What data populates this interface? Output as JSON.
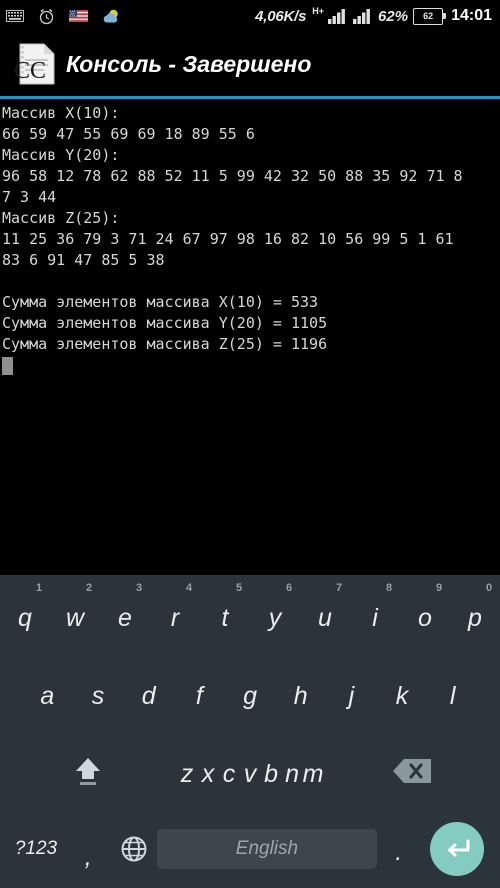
{
  "status_bar": {
    "icons": [
      "keyboard-icon",
      "alarm-clock-icon",
      "us-flag-icon",
      "weather-cloud-icon"
    ],
    "network_speed": "4,06K/s",
    "network_type": "H+",
    "battery_percent": "62%",
    "battery_level_number": "62",
    "clock": "14:01"
  },
  "title_bar": {
    "icon": "c-document-icon",
    "title": "Консоль - Завершено"
  },
  "console": {
    "accent_color": "#2196c4",
    "lines": [
      "Массив X(10):",
      "66 59 47 55 69 69 18 89 55 6",
      "Массив Y(20):",
      "96 58 12 78 62 88 52 11 5 99 42 32 50 88 35 92 71 8",
      "7 3 44",
      "Массив Z(25):",
      "11 25 36 79 3 71 24 67 97 98 16 82 10 56 99 5 1 61",
      "83 6 91 47 85 5 38",
      "",
      "Сумма элементов массива X(10) = 533",
      "Сумма элементов массива Y(20) = 1105",
      "Сумма элементов массива Z(25) = 1196"
    ],
    "arrays": {
      "X": {
        "label": "Массив X(10):",
        "size": 10,
        "values": [
          66,
          59,
          47,
          55,
          69,
          69,
          18,
          89,
          55,
          6
        ],
        "sum_label": "Сумма элементов массива X(10) = 533",
        "sum": 533
      },
      "Y": {
        "label": "Массив Y(20):",
        "size": 20,
        "values": [
          96,
          58,
          12,
          78,
          62,
          88,
          52,
          11,
          5,
          99,
          42,
          32,
          50,
          88,
          35,
          92,
          71,
          8,
          7,
          3,
          44
        ],
        "sum_label": "Сумма элементов массива Y(20) = 1105",
        "sum": 1105
      },
      "Z": {
        "label": "Массив Z(25):",
        "size": 25,
        "values": [
          11,
          25,
          36,
          79,
          3,
          71,
          24,
          67,
          97,
          98,
          16,
          82,
          10,
          56,
          99,
          5,
          1,
          61,
          83,
          6,
          91,
          47,
          85,
          5,
          38
        ],
        "sum_label": "Сумма элементов массива Z(25) = 1196",
        "sum": 1196
      }
    }
  },
  "keyboard": {
    "background_color": "#2b333b",
    "enter_color": "#84cbc2",
    "row1": [
      {
        "letter": "q",
        "hint": "1"
      },
      {
        "letter": "w",
        "hint": "2"
      },
      {
        "letter": "e",
        "hint": "3"
      },
      {
        "letter": "r",
        "hint": "4"
      },
      {
        "letter": "t",
        "hint": "5"
      },
      {
        "letter": "y",
        "hint": "6"
      },
      {
        "letter": "u",
        "hint": "7"
      },
      {
        "letter": "i",
        "hint": "8"
      },
      {
        "letter": "o",
        "hint": "9"
      },
      {
        "letter": "p",
        "hint": "0"
      }
    ],
    "row2": [
      {
        "letter": "a"
      },
      {
        "letter": "s"
      },
      {
        "letter": "d"
      },
      {
        "letter": "f"
      },
      {
        "letter": "g"
      },
      {
        "letter": "h"
      },
      {
        "letter": "j"
      },
      {
        "letter": "k"
      },
      {
        "letter": "l"
      }
    ],
    "row3": [
      {
        "letter": "z"
      },
      {
        "letter": "x"
      },
      {
        "letter": "c"
      },
      {
        "letter": "v"
      },
      {
        "letter": "b"
      },
      {
        "letter": "n"
      },
      {
        "letter": "m"
      }
    ],
    "shift_key": "shift-icon",
    "backspace_key": "backspace-icon",
    "symbols_key": "?123",
    "comma_key": ",",
    "globe_key": "globe-icon",
    "space_key": "English",
    "period_key": ".",
    "enter_key": "enter-icon"
  }
}
